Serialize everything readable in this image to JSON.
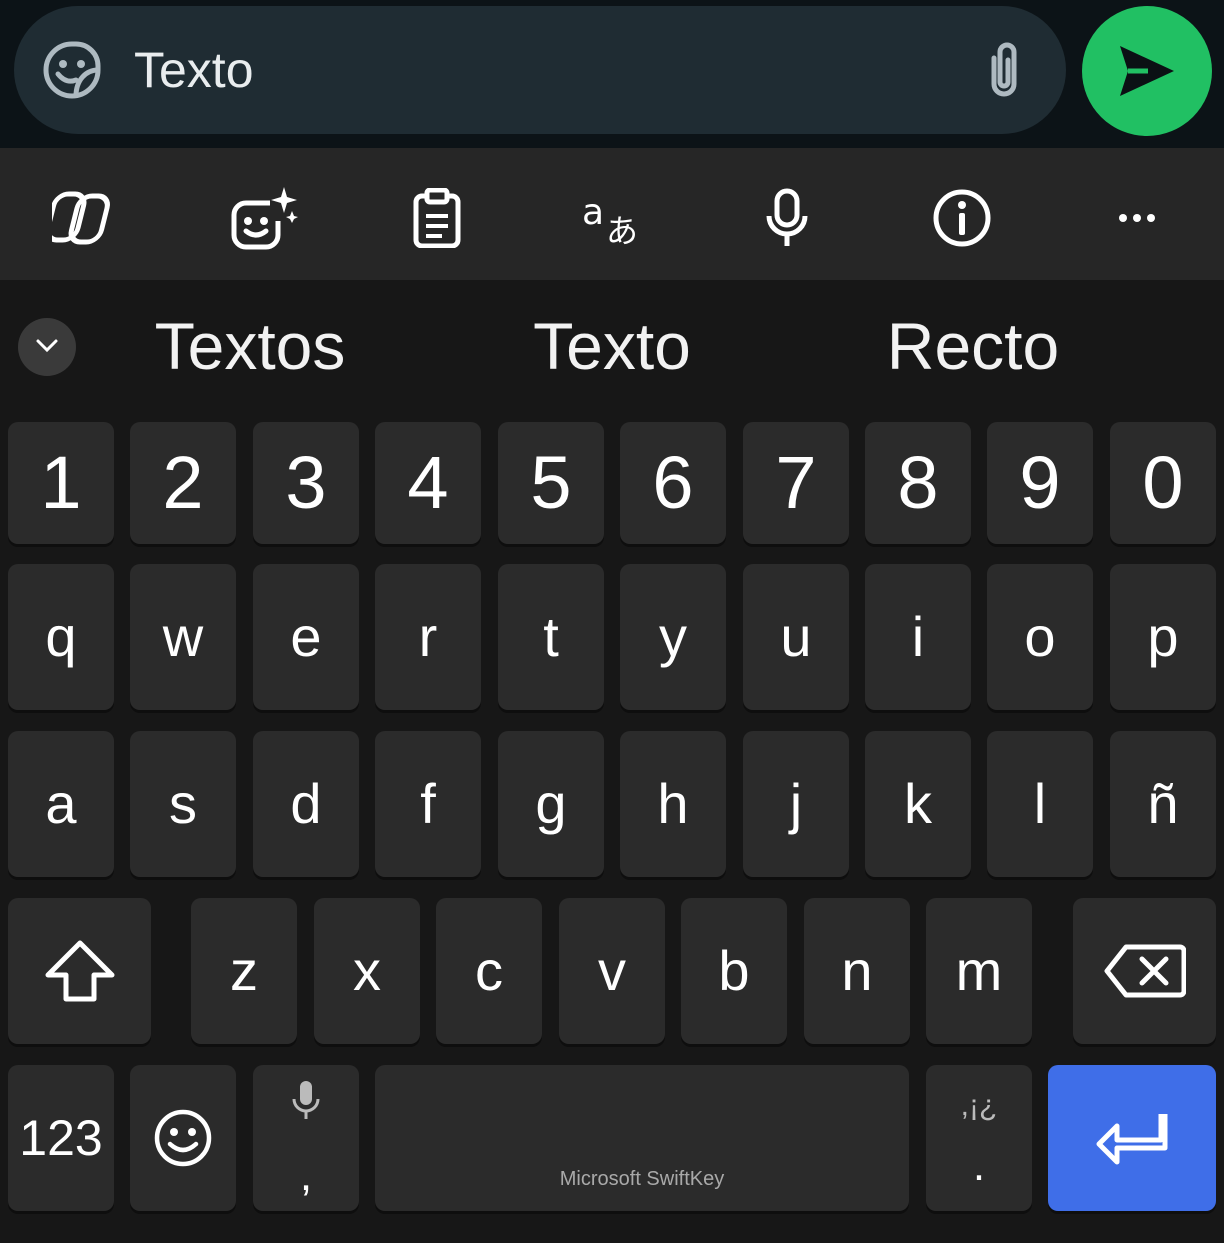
{
  "input": {
    "text": "Texto"
  },
  "icons": {
    "sticker": "sticker-icon",
    "attach": "paperclip-icon",
    "send": "send-icon",
    "copilot": "copilot-icon",
    "stickers_ai": "ai-sticker-icon",
    "clipboard": "clipboard-icon",
    "translate": "translate-icon",
    "voice": "microphone-icon",
    "info": "info-icon",
    "more": "more-icon",
    "collapse": "chevron-down-icon",
    "shift": "shift-icon",
    "backspace": "backspace-icon",
    "emoji": "emoji-icon",
    "enter": "enter-icon"
  },
  "colors": {
    "send": "#21c063",
    "enter": "#3f6ee8",
    "key": "#2b2b2b"
  },
  "suggestions": [
    "Textos",
    "Texto",
    "Recto"
  ],
  "keyboard": {
    "digits": [
      "1",
      "2",
      "3",
      "4",
      "5",
      "6",
      "7",
      "8",
      "9",
      "0"
    ],
    "row1": [
      "q",
      "w",
      "e",
      "r",
      "t",
      "y",
      "u",
      "i",
      "o",
      "p"
    ],
    "row2": [
      "a",
      "s",
      "d",
      "f",
      "g",
      "h",
      "j",
      "k",
      "l",
      "ñ"
    ],
    "row3": [
      "z",
      "x",
      "c",
      "v",
      "b",
      "n",
      "m"
    ],
    "numbers_label": "123",
    "comma": ",",
    "space_label": "Microsoft SwiftKey",
    "punct_top": ",¡¿",
    "punct_main": "."
  }
}
